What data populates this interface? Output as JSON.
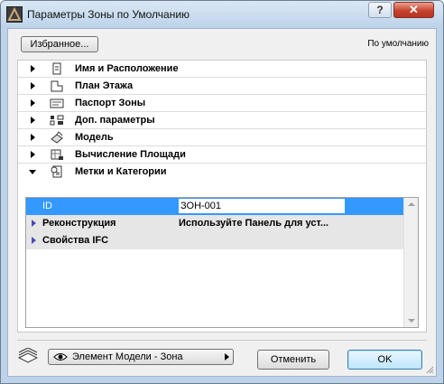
{
  "window": {
    "title": "Параметры Зоны по Умолчанию",
    "help_label": "?",
    "close_label": "✕"
  },
  "toolbar": {
    "favorites_label": "Избранное...",
    "default_label": "По умолчанию"
  },
  "sections": [
    {
      "label": "Имя и Расположение",
      "icon": "document-pin-icon",
      "expanded": false
    },
    {
      "label": "План Этажа",
      "icon": "floor-plan-icon",
      "expanded": false
    },
    {
      "label": "Паспорт Зоны",
      "icon": "zone-stamp-icon",
      "expanded": false
    },
    {
      "label": "Доп. параметры",
      "icon": "extra-parameters-icon",
      "expanded": false
    },
    {
      "label": "Модель",
      "icon": "model-icon",
      "expanded": false
    },
    {
      "label": "Вычисление Площади",
      "icon": "area-calculation-icon",
      "expanded": false
    },
    {
      "label": "Метки и Категории",
      "icon": "tags-categories-icon",
      "expanded": true
    }
  ],
  "properties": {
    "id": {
      "name": "ID",
      "value": "ЗОН-001"
    },
    "renovation": {
      "name": "Реконструкция",
      "value": "Используйте Панель для уст..."
    },
    "ifc": {
      "name": "Свойства IFC"
    }
  },
  "footer": {
    "layer_dropdown": "Элемент Модели - Зона",
    "cancel_label": "Отменить",
    "ok_label": "OK"
  },
  "colors": {
    "selection": "#3399ff",
    "titlebar": "#bcd2e9",
    "close_button": "#c7442e"
  }
}
